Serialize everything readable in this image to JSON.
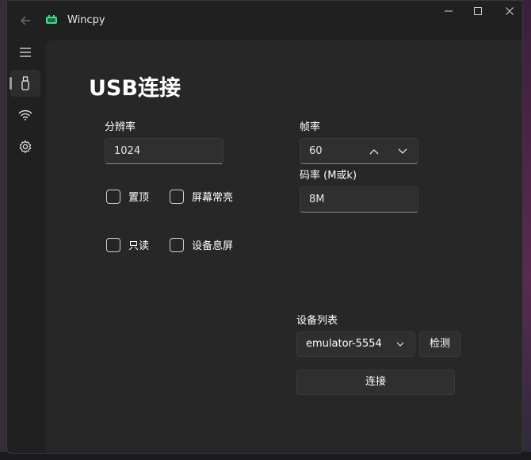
{
  "window": {
    "title": "Wincpy",
    "controls": {
      "minimize_icon": "minimize-icon",
      "maximize_icon": "maximize-icon",
      "close_icon": "close-icon"
    }
  },
  "sidebar": {
    "items": [
      {
        "icon": "hamburger-menu-icon",
        "selected": false
      },
      {
        "icon": "usb-icon",
        "selected": true
      },
      {
        "icon": "wifi-icon",
        "selected": false
      },
      {
        "icon": "gear-icon",
        "selected": false
      }
    ]
  },
  "page": {
    "title": "USB连接",
    "resolution": {
      "label": "分辨率",
      "value": "1024"
    },
    "framerate": {
      "label": "帧率",
      "value": "60"
    },
    "bitrate": {
      "label": "码率 (M或k)",
      "value": "8M"
    },
    "options": [
      {
        "label": "置顶",
        "checked": false
      },
      {
        "label": "屏幕常亮",
        "checked": false
      },
      {
        "label": "只读",
        "checked": false
      },
      {
        "label": "设备息屏",
        "checked": false
      }
    ],
    "devices": {
      "label": "设备列表",
      "selected": "emulator-5554",
      "detect_label": "检测",
      "connect_label": "连接"
    }
  },
  "colors": {
    "window_bg": "#202020",
    "content_bg": "#272727",
    "control_bg": "#2f2f2f"
  }
}
